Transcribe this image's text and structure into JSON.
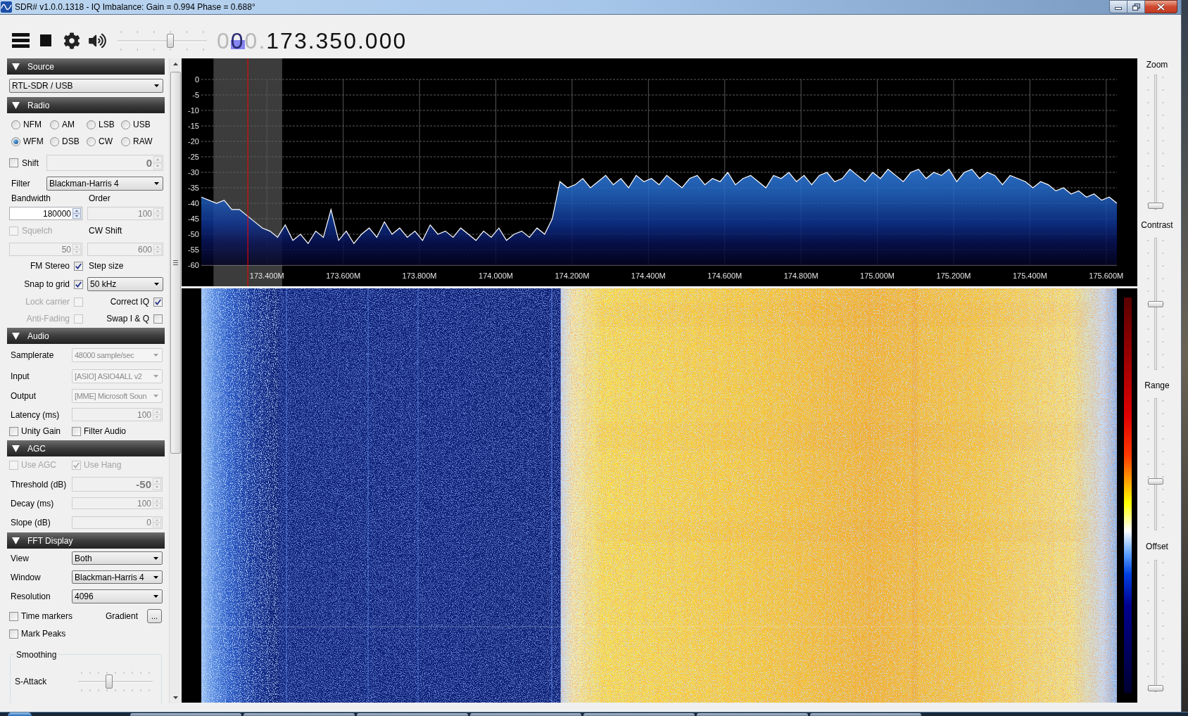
{
  "window": {
    "title": "SDR# v1.0.0.1318 - IQ Imbalance: Gain = 0.994 Phase = 0.688°"
  },
  "toolbar": {
    "volume": {
      "level": 0.6
    }
  },
  "frequency": {
    "segments": [
      {
        "text": "0",
        "dim": true,
        "highlighted": false
      },
      {
        "text": "0",
        "dim": true,
        "highlighted": true
      },
      {
        "text": "0.",
        "dim": true,
        "highlighted": false
      },
      {
        "text": "173.350.000",
        "dim": false,
        "highlighted": false
      }
    ]
  },
  "sidebar": {
    "source": {
      "title": "Source",
      "expanded": true,
      "device": {
        "value": "RTL-SDR / USB",
        "disabled": false
      }
    },
    "radio": {
      "title": "Radio",
      "expanded": true,
      "modes": [
        {
          "label": "NFM",
          "selected": false
        },
        {
          "label": "AM",
          "selected": false
        },
        {
          "label": "LSB",
          "selected": false
        },
        {
          "label": "USB",
          "selected": false
        },
        {
          "label": "WFM",
          "selected": true
        },
        {
          "label": "DSB",
          "selected": false
        },
        {
          "label": "CW",
          "selected": false
        },
        {
          "label": "RAW",
          "selected": false
        }
      ],
      "shift": {
        "label": "Shift",
        "checked": false,
        "disabled": false,
        "field": {
          "value": "0",
          "disabled": true
        }
      },
      "filter": {
        "label": "Filter",
        "value": "Blackman-Harris 4",
        "disabled": false
      },
      "bandwidth": {
        "label": "Bandwidth",
        "value": "180000",
        "disabled": false
      },
      "order": {
        "label": "Order",
        "value": "100",
        "disabled": true
      },
      "squelch": {
        "label": "Squelch",
        "checked": false,
        "disabled": true,
        "field": {
          "value": "50",
          "disabled": true
        }
      },
      "cw_shift": {
        "label": "CW Shift",
        "value": "600",
        "disabled": true
      },
      "fm_stereo": {
        "label": "FM Stereo",
        "checked": true,
        "disabled": false
      },
      "step_size": {
        "label": "Step size",
        "value": "50 kHz",
        "disabled": false
      },
      "snap_to_grid": {
        "label": "Snap to grid",
        "checked": true,
        "disabled": false
      },
      "lock_carrier": {
        "label": "Lock carrier",
        "checked": false,
        "disabled": true
      },
      "correct_iq": {
        "label": "Correct IQ",
        "checked": true,
        "disabled": false
      },
      "anti_fading": {
        "label": "Anti-Fading",
        "checked": false,
        "disabled": true
      },
      "swap_iq": {
        "label": "Swap I & Q",
        "checked": false,
        "disabled": false
      }
    },
    "audio": {
      "title": "Audio",
      "expanded": true,
      "samplerate": {
        "label": "Samplerate",
        "value": "48000 sample/sec",
        "disabled": true
      },
      "input": {
        "label": "Input",
        "value": "[ASIO] ASIO4ALL v2",
        "disabled": true
      },
      "output": {
        "label": "Output",
        "value": "[MME] Microsoft Soun",
        "disabled": true
      },
      "latency": {
        "label": "Latency (ms)",
        "value": "100",
        "disabled": true
      },
      "unity_gain": {
        "label": "Unity Gain",
        "checked": false,
        "disabled": false
      },
      "filter_audio": {
        "label": "Filter Audio",
        "checked": false,
        "disabled": false
      }
    },
    "agc": {
      "title": "AGC",
      "expanded": true,
      "use_agc": {
        "label": "Use AGC",
        "checked": false,
        "disabled": true
      },
      "use_hang": {
        "label": "Use Hang",
        "checked": true,
        "disabled": true
      },
      "threshold": {
        "label": "Threshold (dB)",
        "value": "-50",
        "disabled": true
      },
      "decay": {
        "label": "Decay (ms)",
        "value": "100",
        "disabled": true
      },
      "slope": {
        "label": "Slope (dB)",
        "value": "0",
        "disabled": true
      }
    },
    "fft_display": {
      "title": "FFT Display",
      "expanded": true,
      "view": {
        "label": "View",
        "value": "Both",
        "disabled": false
      },
      "window": {
        "label": "Window",
        "value": "Blackman-Harris 4",
        "disabled": false
      },
      "resolution": {
        "label": "Resolution",
        "value": "4096",
        "disabled": false
      },
      "time_markers": {
        "label": "Time markers",
        "checked": false,
        "disabled": false
      },
      "gradient": {
        "label": "Gradient",
        "button": "..."
      },
      "mark_peaks": {
        "label": "Mark Peaks",
        "checked": false,
        "disabled": false
      },
      "smoothing": {
        "title": "Smoothing",
        "s_attack": {
          "label": "S-Attack",
          "level": 0.4
        }
      }
    }
  },
  "spectrum": {
    "chart_data": [
      {
        "type": "line",
        "xlim": [
          173.228,
          175.628
        ],
        "ylim": [
          -60,
          0
        ],
        "xticks": [
          {
            "value": 173.4,
            "label": "173.400M"
          },
          {
            "value": 173.6,
            "label": "173.600M"
          },
          {
            "value": 173.8,
            "label": "173.800M"
          },
          {
            "value": 174.0,
            "label": "174.000M"
          },
          {
            "value": 174.2,
            "label": "174.200M"
          },
          {
            "value": 174.4,
            "label": "174.400M"
          },
          {
            "value": 174.6,
            "label": "174.600M"
          },
          {
            "value": 174.8,
            "label": "174.800M"
          },
          {
            "value": 175.0,
            "label": "175.000M"
          },
          {
            "value": 175.2,
            "label": "175.200M"
          },
          {
            "value": 175.4,
            "label": "175.400M"
          },
          {
            "value": 175.6,
            "label": "175.600M"
          }
        ],
        "yticks": [
          0,
          -5,
          -10,
          -15,
          -20,
          -25,
          -30,
          -35,
          -40,
          -45,
          -50,
          -55,
          -60
        ],
        "grid": true,
        "color": "#ffffff",
        "x": [
          173.228,
          173.248,
          173.268,
          173.288,
          173.308,
          173.328,
          173.348,
          173.368,
          173.388,
          173.408,
          173.428,
          173.448,
          173.468,
          173.488,
          173.508,
          173.528,
          173.548,
          173.568,
          173.588,
          173.608,
          173.628,
          173.648,
          173.668,
          173.688,
          173.708,
          173.728,
          173.748,
          173.768,
          173.788,
          173.808,
          173.828,
          173.848,
          173.868,
          173.888,
          173.908,
          173.928,
          173.948,
          173.968,
          173.988,
          174.008,
          174.028,
          174.048,
          174.068,
          174.088,
          174.108,
          174.128,
          174.148,
          174.168,
          174.188,
          174.208,
          174.228,
          174.248,
          174.268,
          174.288,
          174.308,
          174.328,
          174.348,
          174.368,
          174.388,
          174.408,
          174.428,
          174.448,
          174.468,
          174.488,
          174.508,
          174.528,
          174.548,
          174.568,
          174.588,
          174.608,
          174.628,
          174.648,
          174.668,
          174.688,
          174.708,
          174.728,
          174.748,
          174.768,
          174.788,
          174.808,
          174.828,
          174.848,
          174.868,
          174.888,
          174.908,
          174.928,
          174.948,
          174.968,
          174.988,
          175.008,
          175.028,
          175.048,
          175.068,
          175.088,
          175.108,
          175.128,
          175.148,
          175.168,
          175.188,
          175.208,
          175.228,
          175.248,
          175.268,
          175.288,
          175.308,
          175.328,
          175.348,
          175.368,
          175.388,
          175.408,
          175.428,
          175.448,
          175.468,
          175.488,
          175.508,
          175.528,
          175.548,
          175.568,
          175.588,
          175.608,
          175.628
        ],
        "values": [
          -38,
          -39,
          -40,
          -39,
          -42,
          -42,
          -44,
          -46,
          -48,
          -49,
          -51,
          -47,
          -52,
          -50,
          -53,
          -49,
          -51,
          -42,
          -52,
          -49,
          -53,
          -50,
          -48,
          -51,
          -46,
          -50,
          -48,
          -51,
          -49,
          -52,
          -47,
          -50,
          -49,
          -51,
          -48,
          -50,
          -52,
          -49,
          -51,
          -48,
          -52,
          -50,
          -49,
          -51,
          -48,
          -50,
          -45,
          -33,
          -35,
          -34,
          -32,
          -35,
          -33,
          -31,
          -34,
          -32,
          -35,
          -31,
          -33,
          -32,
          -34,
          -31,
          -33,
          -35,
          -32,
          -31,
          -34,
          -32,
          -33,
          -30,
          -34,
          -32,
          -31,
          -33,
          -35,
          -31,
          -32,
          -30,
          -33,
          -31,
          -34,
          -31,
          -30,
          -33,
          -32,
          -29,
          -31,
          -33,
          -30,
          -32,
          -29,
          -31,
          -33,
          -30,
          -29,
          -32,
          -30,
          -31,
          -29,
          -33,
          -30,
          -29,
          -32,
          -30,
          -31,
          -34,
          -31,
          -32,
          -33,
          -35,
          -33,
          -34,
          -36,
          -35,
          -37,
          -36,
          -38,
          -37,
          -39,
          -38,
          -40
        ],
        "bands": [
          {
            "axis": "x",
            "from": 173.26,
            "to": 173.44,
            "color": "#3c3c3c"
          }
        ],
        "ref_lines": [
          {
            "axis": "x",
            "value": 173.35,
            "color": "#ff0000"
          }
        ]
      }
    ]
  },
  "display_controls": [
    {
      "label": "Zoom",
      "level": 0
    },
    {
      "label": "Contrast",
      "level": 0.5
    },
    {
      "label": "Range",
      "level": 0.36
    },
    {
      "label": "Offset",
      "level": 0
    }
  ]
}
